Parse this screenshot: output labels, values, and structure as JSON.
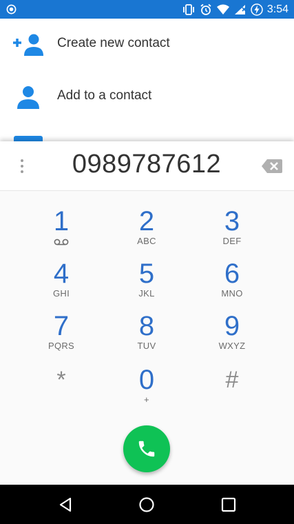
{
  "status_bar": {
    "time": "3:54",
    "background": "#1976d2",
    "icons": [
      "record-icon",
      "vibrate-icon",
      "alarm-icon",
      "wifi-icon",
      "signal-icon",
      "battery-charging-icon"
    ]
  },
  "contact_actions": [
    {
      "label": "Create new contact",
      "icon": "add-person-icon"
    },
    {
      "label": "Add to a contact",
      "icon": "person-icon"
    }
  ],
  "dialer": {
    "number": "0989787612",
    "keys": [
      {
        "digit": "1",
        "letters": "",
        "extra": "voicemail-icon"
      },
      {
        "digit": "2",
        "letters": "ABC"
      },
      {
        "digit": "3",
        "letters": "DEF"
      },
      {
        "digit": "4",
        "letters": "GHI"
      },
      {
        "digit": "5",
        "letters": "JKL"
      },
      {
        "digit": "6",
        "letters": "MNO"
      },
      {
        "digit": "7",
        "letters": "PQRS"
      },
      {
        "digit": "8",
        "letters": "TUV"
      },
      {
        "digit": "9",
        "letters": "WXYZ"
      },
      {
        "digit": "*",
        "letters": ""
      },
      {
        "digit": "0",
        "letters": "+"
      },
      {
        "digit": "#",
        "letters": ""
      }
    ],
    "call_color": "#0fc255",
    "digit_color": "#2f6fc9"
  },
  "nav_bar": {
    "buttons": [
      "back-icon",
      "home-icon",
      "recents-icon"
    ]
  }
}
